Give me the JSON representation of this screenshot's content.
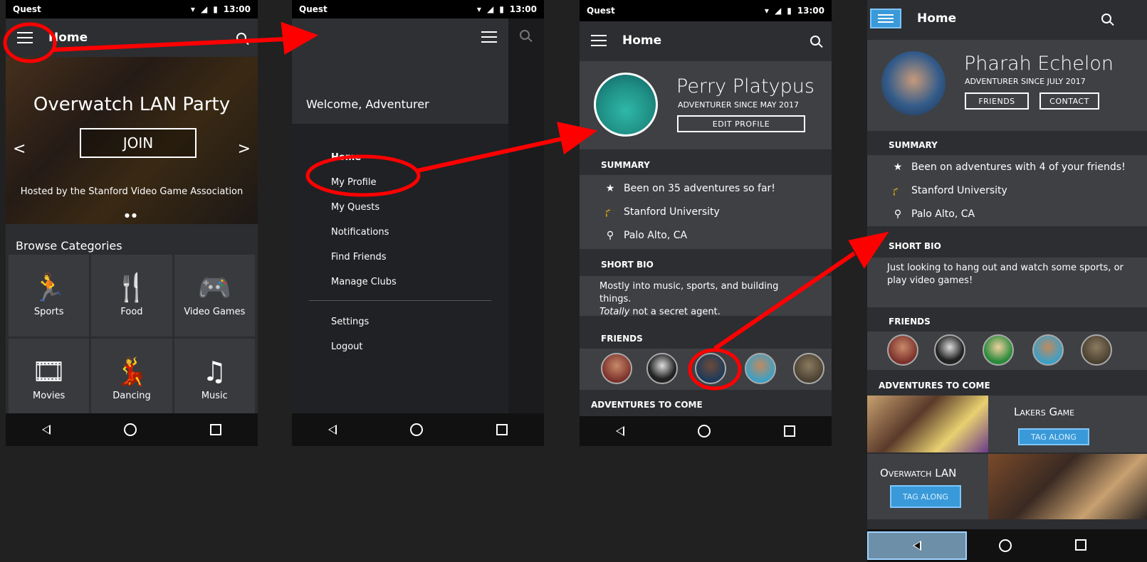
{
  "status": {
    "carrier": "Quest",
    "time": "13:00"
  },
  "screen1": {
    "title": "Home",
    "event_title": "Overwatch LAN Party",
    "join_label": "JOIN",
    "hosted_by": "Hosted by the Stanford Video Game Association",
    "prev": "<",
    "next": ">",
    "dots": "●●",
    "browse_label": "Browse Categories",
    "categories": [
      {
        "label": "Sports",
        "icon": "running-icon"
      },
      {
        "label": "Food",
        "icon": "utensils-icon"
      },
      {
        "label": "Video Games",
        "icon": "gamepad-icon"
      },
      {
        "label": "Movies",
        "icon": "film-icon"
      },
      {
        "label": "Dancing",
        "icon": "dancing-icon"
      },
      {
        "label": "Music",
        "icon": "music-note-icon"
      }
    ]
  },
  "screen2": {
    "welcome": "Welcome, Adventurer",
    "menu": [
      "Home",
      "My Profile",
      "My Quests",
      "Notifications",
      "Find Friends",
      "Manage Clubs"
    ],
    "menu_bottom": [
      "Settings",
      "Logout"
    ]
  },
  "screen3": {
    "title": "Home",
    "name": "Perry Platypus",
    "since": "Adventurer since may 2017",
    "edit_label": "EDIT PROFILE",
    "summary_header": "SUMMARY",
    "summary": [
      {
        "icon": "star-icon",
        "text": "Been on 35 adventures so far!"
      },
      {
        "icon": "graduation-cap-icon",
        "text": "Stanford University"
      },
      {
        "icon": "location-pin-icon",
        "text": "Palo Alto, CA"
      }
    ],
    "bio_header": "SHORT BIO",
    "bio_line1": "Mostly into music, sports, and building things.",
    "bio_em": "Totally",
    "bio_line2": " not a secret agent.",
    "friends_header": "FRIENDS",
    "adventures_header": "ADVENTURES TO COME"
  },
  "screen4": {
    "title": "Home",
    "name": "Pharah Echelon",
    "since": "Adventurer since july 2017",
    "friends_label": "FRIENDS",
    "contact_label": "CONTACT",
    "summary_header": "SUMMARY",
    "summary": [
      {
        "icon": "star-icon",
        "text": "Been on adventures with 4 of your friends!"
      },
      {
        "icon": "graduation-cap-icon",
        "text": "Stanford University"
      },
      {
        "icon": "location-pin-icon",
        "text": "Palo Alto, CA"
      }
    ],
    "bio_header": "SHORT BIO",
    "bio": "Just looking to hang out and watch some sports, or play video games!",
    "friends_header": "FRIENDS",
    "adventures_header": "ADVENTURES TO COME",
    "events": [
      {
        "title": "Lakers Game",
        "tag": "TAG ALONG"
      },
      {
        "title": "Overwatch LAN",
        "tag": "TAG ALONG"
      }
    ]
  },
  "colors": {
    "annotation": "#ff0000",
    "accent": "#3a9ad9"
  }
}
